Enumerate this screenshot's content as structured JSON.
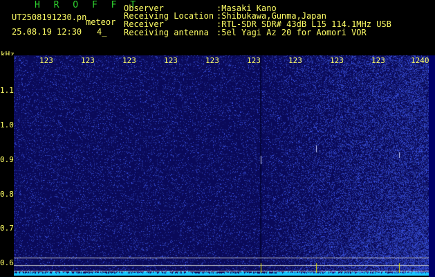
{
  "header": {
    "brand": "H R O F F T",
    "filename": "UT2508191230.pn",
    "meteor_label": "meteor",
    "timestamp": "25.08.19 12:30",
    "count": "4_",
    "fields": [
      {
        "label": "Observer",
        "value": ":Masaki Kano"
      },
      {
        "label": "Receiving Location",
        "value": ":Shibukawa,Gunma,Japan"
      },
      {
        "label": "Receiver",
        "value": ":RTL-SDR SDR# 43dB L15 114.1MHz USB"
      },
      {
        "label": "Receiving antenna",
        "value": ":5el Yagi Az 20 for Aomori VOR"
      }
    ]
  },
  "axes": {
    "y_unit": "kHz",
    "y_ticks": [
      "1.1",
      "1.0",
      "0.9",
      "0.8",
      "0.7",
      "0.6"
    ],
    "x_ticks": [
      "123",
      "123",
      "123",
      "123",
      "123",
      "123",
      "123",
      "123",
      "123",
      "1240"
    ]
  },
  "colors": {
    "background": "#000000",
    "text": "#ffff66",
    "brand": "#2fd22f",
    "waterfall": "#0a0a5a",
    "noise": "#2a44d0",
    "trace": "#18c8ff"
  }
}
